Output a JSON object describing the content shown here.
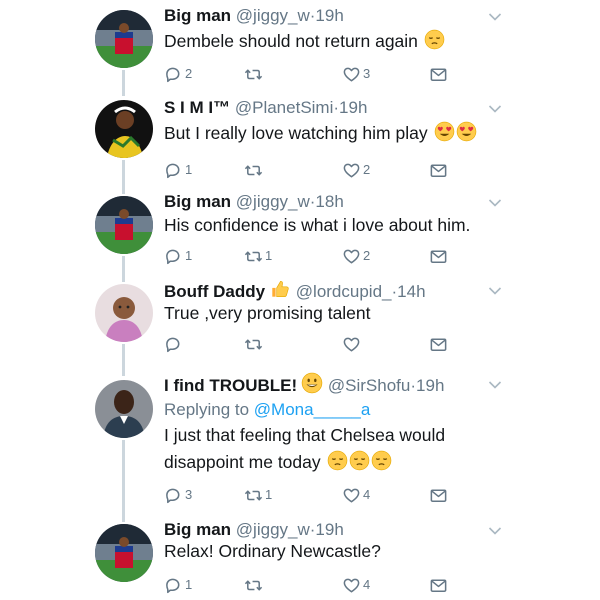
{
  "tweets": [
    {
      "name": "Big man",
      "handle": "@jiggy_w",
      "dot": "·",
      "time": "19h",
      "text_lines": [
        "Dembele should not return again"
      ],
      "reply_count": "2",
      "retweet_count": "",
      "like_count": "3",
      "avatar": "stadium-avatar",
      "text_emoji": [
        "pensive-face"
      ]
    },
    {
      "name": "S I M I™",
      "handle": "@PlanetSimi",
      "dot": "·",
      "time": "19h",
      "text_lines": [
        "But I really love watching him play"
      ],
      "reply_count": "1",
      "retweet_count": "",
      "like_count": "2",
      "avatar": "person-avatar",
      "text_emoji": [
        "heart-eyes-face",
        "heart-eyes-face"
      ]
    },
    {
      "name": "Big man",
      "handle": "@jiggy_w",
      "dot": "·",
      "time": "18h",
      "text_lines": [
        "His confidence is what i love about him."
      ],
      "reply_count": "1",
      "retweet_count": "1",
      "like_count": "2",
      "avatar": "stadium-avatar",
      "text_emoji": []
    },
    {
      "name": "Bouff Daddy",
      "handle": "@lordcupid_",
      "dot": "·",
      "time": "14h",
      "text_lines": [
        "True ,very promising talent"
      ],
      "reply_count": "",
      "retweet_count": "",
      "like_count": "",
      "avatar": "baby-avatar",
      "name_emoji": [
        "thumbs-up"
      ],
      "text_emoji": []
    },
    {
      "name": "I find TROUBLE!",
      "handle": "@SirShofu",
      "dot": "·",
      "time": "19h",
      "reply_prefix": "Replying to",
      "reply_mention": "@Mona_____a",
      "text_lines": [
        "I just that feeling that Chelsea would",
        "disappoint me today"
      ],
      "reply_count": "3",
      "retweet_count": "1",
      "like_count": "4",
      "avatar": "man-avatar",
      "name_emoji": [
        "grinning-face"
      ],
      "text_emoji": [
        "pensive-face",
        "pensive-face",
        "pensive-face"
      ]
    },
    {
      "name": "Big man",
      "handle": "@jiggy_w",
      "dot": "·",
      "time": "19h",
      "text_lines": [
        "Relax! Ordinary Newcastle?"
      ],
      "reply_count": "1",
      "retweet_count": "",
      "like_count": "4",
      "avatar": "stadium-avatar",
      "text_emoji": []
    }
  ],
  "colors": {
    "icon_gray": "#657786",
    "mention_blue": "#1da1f2",
    "thread_line": "#ccd6dd",
    "emoji_yellow": "#ffcc4d",
    "heart_red": "#dd2e44"
  }
}
